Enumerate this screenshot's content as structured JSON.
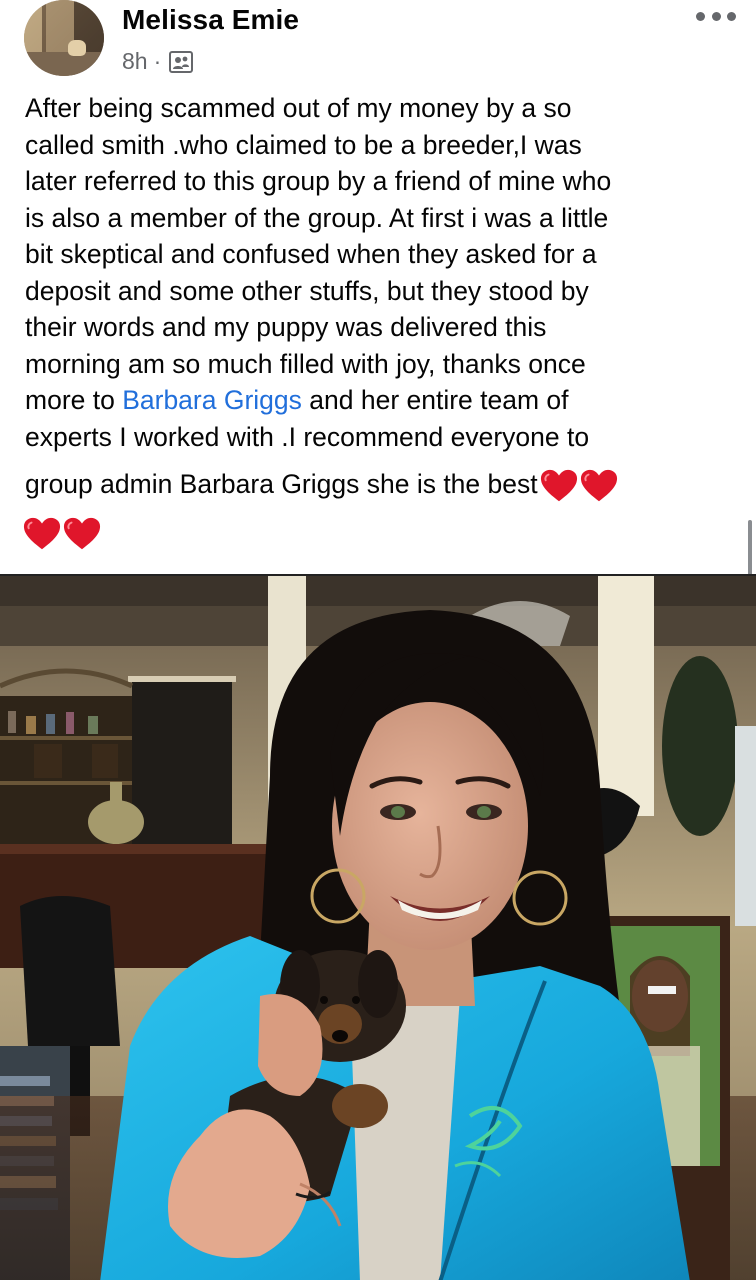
{
  "post": {
    "author": "Melissa Emie",
    "timestamp": "8h",
    "separator": "·",
    "privacy_icon": "friends-icon",
    "more_icon": "more-options-icon",
    "text_lines": [
      "After being scammed out of my money by a so",
      "called smith .who claimed to be a breeder,I was",
      "later referred to this group by a friend of mine who",
      "is also a member of the group. At first i was a little",
      "bit skeptical and confused when they asked for a",
      "deposit and some other stuffs, but they stood by",
      "their words and my puppy was delivered this",
      "morning am so much filled with joy, thanks once"
    ],
    "line9_before": "more to ",
    "mention": "Barbara Griggs",
    "line9_after": " and her entire team of",
    "line10": "experts I worked with .I recommend everyone to",
    "line11": "group admin Barbara Griggs she is the best",
    "heart_icon": "red-heart-emoji",
    "heart_color": "#e0162b",
    "mention_color": "#216fdb"
  },
  "photo": {
    "content": "photo-woman-holding-puppy"
  }
}
